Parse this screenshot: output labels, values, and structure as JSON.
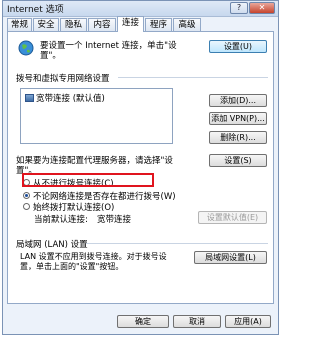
{
  "window": {
    "title": "Internet 选项",
    "help_label": "?",
    "close_label": "✕"
  },
  "tabs": [
    "常规",
    "安全",
    "隐私",
    "内容",
    "连接",
    "程序",
    "高级"
  ],
  "active_tab": "连接",
  "setup": {
    "text_line1": "要设置一个 Internet 连接，单击\"设",
    "text_line2": "置\"。",
    "button": "设置(U)"
  },
  "dialup": {
    "heading": "拨号和虚拟专用网络设置",
    "list_items": [
      "宽带连接 (默认值)"
    ],
    "add_button": "添加(D)...",
    "add_vpn_button": "添加 VPN(P)...",
    "remove_button": "删除(R)...",
    "proxy_text_line1": "如果要为连接配置代理服务器，请选择\"设",
    "proxy_text_line2": "置\"。",
    "settings_button": "设置(S)",
    "options": [
      {
        "label": "从不进行拨号连接(C)",
        "checked": false
      },
      {
        "label": "不论网络连接是否存在都进行拨号(W)",
        "checked": true
      },
      {
        "label": "始终拨打默认连接(O)",
        "checked": false
      }
    ],
    "current_default_label": "当前默认连接:",
    "current_default_value": "宽带连接",
    "set_default_button": "设置默认值(E)"
  },
  "lan": {
    "heading": "局域网 (LAN) 设置",
    "text_line1": "LAN 设置不应用到拨号连接。对于拨号设",
    "text_line2": "置，单击上面的\"设置\"按钮。",
    "button": "局域网设置(L)"
  },
  "footer": {
    "ok_button": "确定",
    "cancel_button": "取消",
    "apply_button": "应用(A)"
  },
  "colors": {
    "highlight": "#e0141e",
    "panel_border": "#93a9c8"
  }
}
